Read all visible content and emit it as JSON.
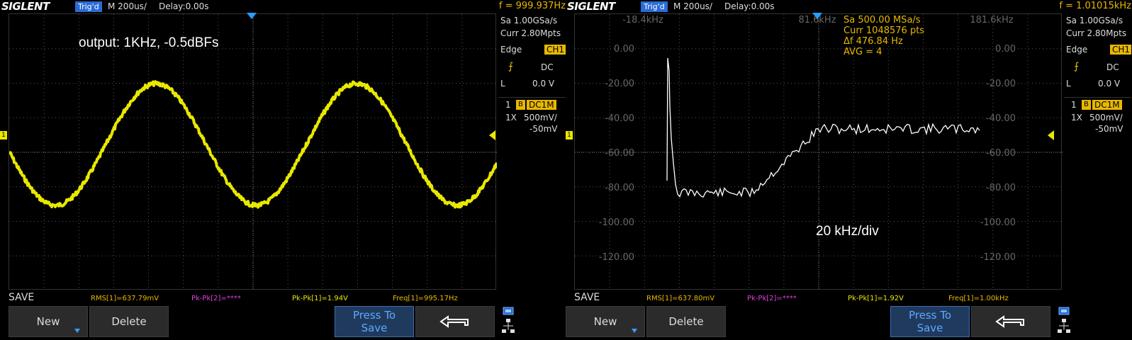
{
  "left": {
    "brand": "SIGLENT",
    "trig_status": "Trig'd",
    "timebase": "M 200us/",
    "delay": "Delay:0.00s",
    "freq_counter": "f = 999.937Hz",
    "sample_rate": "Sa 1.00GSa/s",
    "memory_depth": "Curr 2.80Mpts",
    "trigger_type": "Edge",
    "trigger_source": "CH1",
    "coupling": "DC",
    "level_label": "L",
    "level_value": "0.0 V",
    "channel_num": "1",
    "channel_badge": "B",
    "channel_coupling": "DC1M",
    "probe": "1X",
    "vscale": "500mV/",
    "offset": "-50mV",
    "annotation": "output: 1KHz, -0.5dBFs",
    "menu_label": "SAVE",
    "measurements": {
      "rms": "RMS[1]=637.79mV",
      "pkpk2": "Pk-Pk[2]=****",
      "pkpk1": "Pk-Pk[1]=1.94V",
      "freq": "Freq[1]=995.17Hz"
    },
    "buttons": {
      "new": "New",
      "delete": "Delete",
      "press_to": "Press To",
      "save": "Save"
    }
  },
  "right": {
    "brand": "SIGLENT",
    "trig_status": "Trig'd",
    "timebase": "M 200us/",
    "delay": "Delay:0.00s",
    "freq_counter": "f = 1.01015kHz",
    "sample_rate": "Sa 1.00GSa/s",
    "memory_depth": "Curr 2.80Mpts",
    "trigger_type": "Edge",
    "trigger_source": "CH1",
    "coupling": "DC",
    "level_label": "L",
    "level_value": "0.0 V",
    "channel_num": "1",
    "channel_badge": "B",
    "channel_coupling": "DC1M",
    "probe": "1X",
    "vscale": "500mV/",
    "offset": "-50mV",
    "fft_freq_labels": [
      "-18.4kHz",
      "81.6kHz",
      "181.6kHz"
    ],
    "fft_info": [
      "Sa 500.00 MSa/s",
      "Curr 1048576 pts",
      "Δf 476.84 Hz",
      "AVG = 4"
    ],
    "db_labels": [
      "0.00",
      "-20.00",
      "-40.00",
      "-60.00",
      "-80.00",
      "-100.00",
      "-120.00"
    ],
    "annotation": "20 kHz/div",
    "menu_label": "SAVE",
    "measurements": {
      "rms": "RMS[1]=637.80mV",
      "pkpk2": "Pk-Pk[2]=****",
      "pkpk1": "Pk-Pk[1]=1.92V",
      "freq": "Freq[1]=1.00kHz"
    },
    "buttons": {
      "new": "New",
      "delete": "Delete",
      "press_to": "Press To",
      "save": "Save"
    }
  },
  "colors": {
    "ch1": "#e8e800",
    "fft": "#ffffff",
    "grid": "#555555",
    "accent": "#2a6bd6",
    "rms": "#e8b800",
    "pkpk2": "#e040e0",
    "pkpk1": "#e8e800",
    "freq": "#e8b800"
  }
}
